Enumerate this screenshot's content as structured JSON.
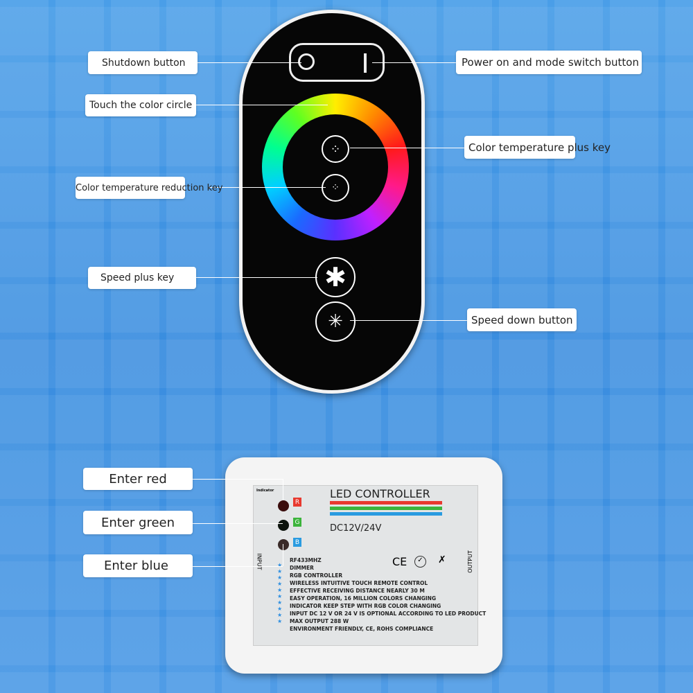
{
  "remote_labels": {
    "shutdown": "Shutdown button",
    "touch_circle": "Touch the color circle",
    "temp_reduce": "Color temperature reduction key",
    "speed_plus": "Speed plus key",
    "power_mode": "Power on and mode switch button",
    "temp_plus": "Color temperature plus key",
    "speed_down": "Speed down button"
  },
  "controller_labels": {
    "red": "Enter red",
    "green": "Enter green",
    "blue": "Enter blue"
  },
  "controller": {
    "indicator": "Indicator",
    "title": "LED CONTROLLER",
    "voltage": "DC12V/24V",
    "input": "INPUT",
    "output": "OUTPUT",
    "r": "R",
    "g": "G",
    "b": "B",
    "ce": "CE",
    "features": [
      "RF433MHZ",
      "DIMMER",
      "RGB CONTROLLER",
      "WIRELESS INTUITIVE TOUCH REMOTE CONTROL",
      "EFFECTIVE RECEIVING DISTANCE NEARLY 30 M",
      "EASY OPERATION, 16 MILLION COLORS CHANGING",
      "INDICATOR KEEP STEP WITH RGB COLOR CHANGING",
      "INPUT DC 12 V OR 24 V IS OPTIONAL ACCORDING TO LED  PRODUCT",
      "MAX OUTPUT 288 W",
      "ENVIRONMENT FRIENDLY, CE, ROHS COMPLIANCE"
    ]
  },
  "colors": {
    "red": "#e8392f",
    "green": "#3cb43c",
    "blue": "#2a9be0",
    "background": "#3f8fe0"
  }
}
